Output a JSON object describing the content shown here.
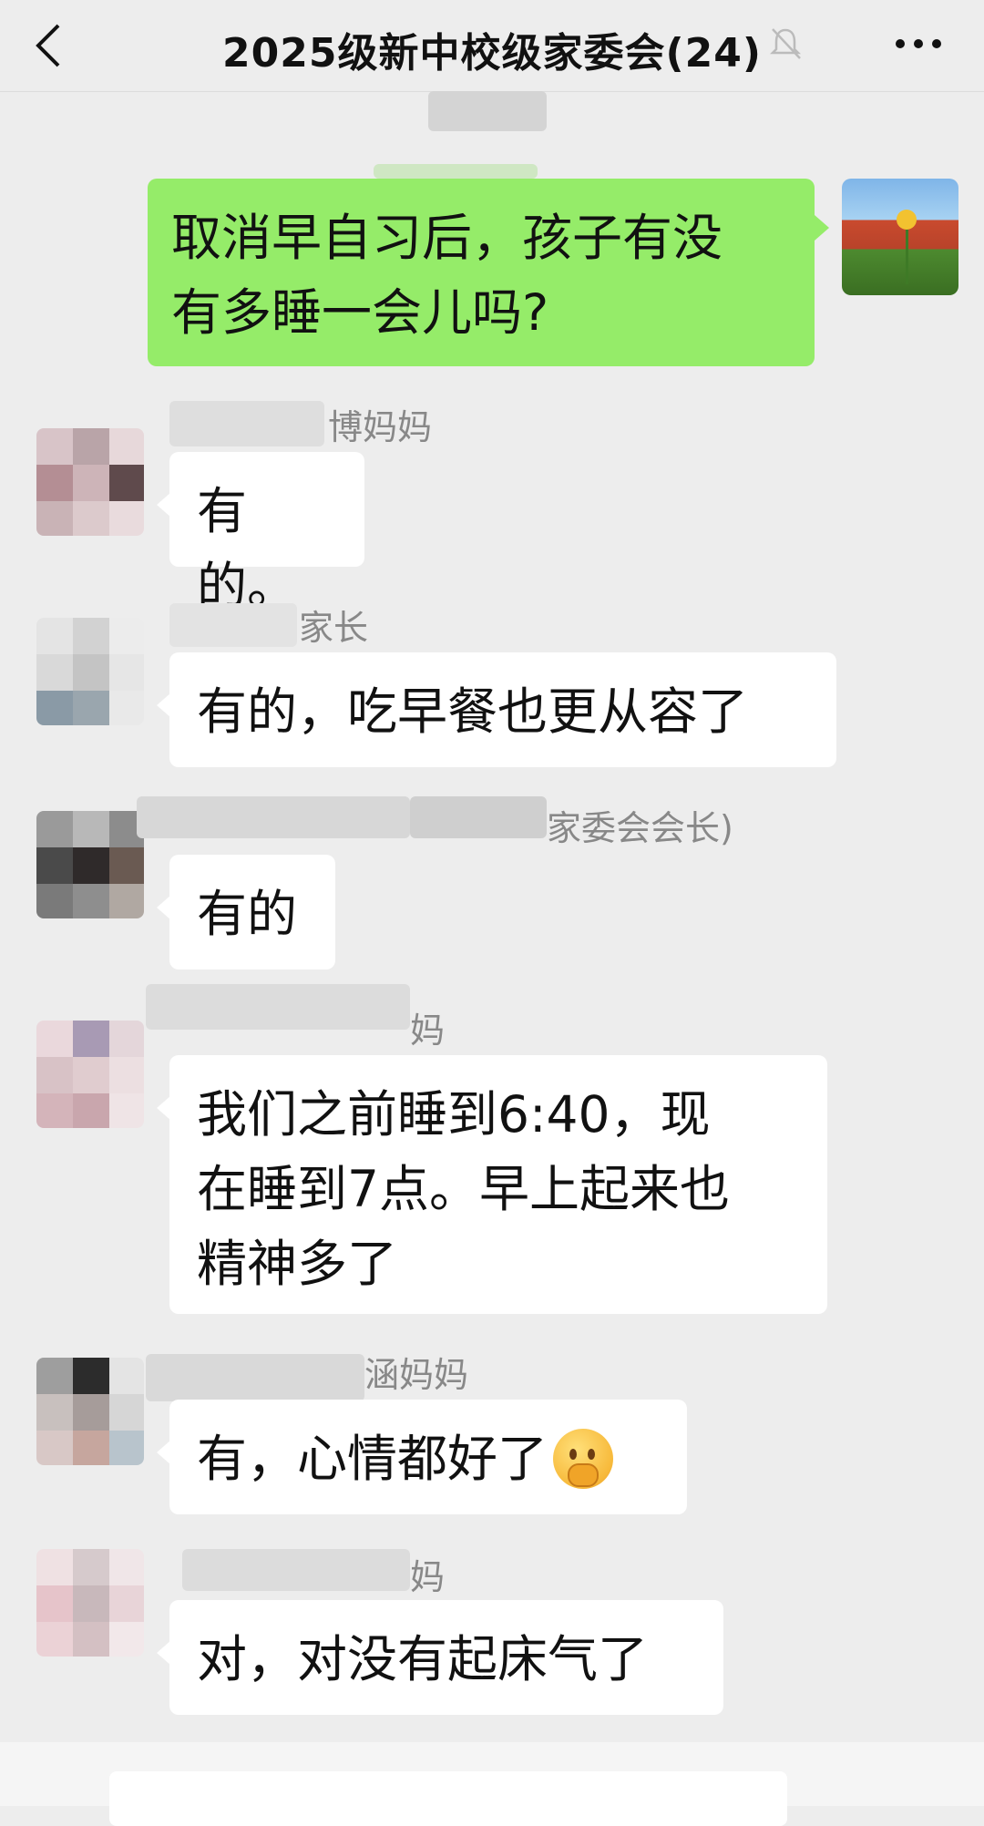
{
  "header": {
    "title": "2025级新中校级家委会(24)",
    "back_icon": "chevron-left-icon",
    "mute_icon": "bell-muted-icon",
    "more_icon": "more-dots-icon"
  },
  "messages": [
    {
      "sender": "self",
      "text_lines": [
        "取消早自习后，孩子有没",
        "有多睡一会儿吗?"
      ]
    },
    {
      "sender_name_visible": "博妈妈",
      "text": "有的。"
    },
    {
      "sender_name_visible": "家长",
      "text": "有的，吃早餐也更从容了"
    },
    {
      "sender_name_visible": "家委会会长)",
      "text": "有的"
    },
    {
      "sender_name_visible": "妈",
      "text_lines": [
        "我们之前睡到6:40，现",
        "在睡到7点。早上起来也",
        "精神多了"
      ]
    },
    {
      "sender_name_visible": "涵妈妈",
      "text": "有，心情都好了",
      "emoji": "thinking-face-hand-emoji"
    },
    {
      "sender_name_visible": "妈",
      "text": "对，对没有起床气了"
    }
  ],
  "colors": {
    "background": "#ededed",
    "self_bubble": "#95ec69",
    "other_bubble": "#ffffff",
    "name_text": "#888888"
  }
}
